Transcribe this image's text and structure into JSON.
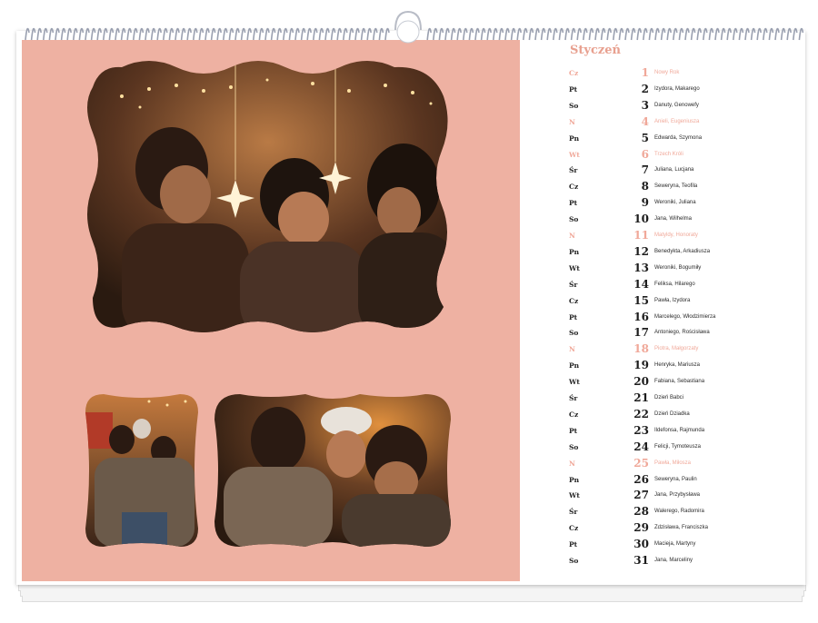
{
  "calendar": {
    "month": "Styczeń",
    "days": [
      {
        "day": "Cz",
        "num": "1",
        "names": "Nowy Rok",
        "holiday": true
      },
      {
        "day": "Pt",
        "num": "2",
        "names": "Izydora, Makarego",
        "holiday": false
      },
      {
        "day": "So",
        "num": "3",
        "names": "Danuty, Genowefy",
        "holiday": false
      },
      {
        "day": "N",
        "num": "4",
        "names": "Anieli, Eugeniusza",
        "holiday": true
      },
      {
        "day": "Pn",
        "num": "5",
        "names": "Edwarda, Szymona",
        "holiday": false
      },
      {
        "day": "Wt",
        "num": "6",
        "names": "Trzech Króli",
        "holiday": true
      },
      {
        "day": "Śr",
        "num": "7",
        "names": "Juliana, Lucjana",
        "holiday": false
      },
      {
        "day": "Cz",
        "num": "8",
        "names": "Seweryna, Teofila",
        "holiday": false
      },
      {
        "day": "Pt",
        "num": "9",
        "names": "Weroniki, Juliana",
        "holiday": false
      },
      {
        "day": "So",
        "num": "10",
        "names": "Jana, Wilhelma",
        "holiday": false
      },
      {
        "day": "N",
        "num": "11",
        "names": "Matyldy, Honoraty",
        "holiday": true
      },
      {
        "day": "Pn",
        "num": "12",
        "names": "Benedykta, Arkadiusza",
        "holiday": false
      },
      {
        "day": "Wt",
        "num": "13",
        "names": "Weroniki, Bogumiły",
        "holiday": false
      },
      {
        "day": "Śr",
        "num": "14",
        "names": "Feliksa, Hilarego",
        "holiday": false
      },
      {
        "day": "Cz",
        "num": "15",
        "names": "Pawła, Izydora",
        "holiday": false
      },
      {
        "day": "Pt",
        "num": "16",
        "names": "Marcelego, Włodzimierza",
        "holiday": false
      },
      {
        "day": "So",
        "num": "17",
        "names": "Antoniego, Rościsława",
        "holiday": false
      },
      {
        "day": "N",
        "num": "18",
        "names": "Piotra, Małgorzaty",
        "holiday": true
      },
      {
        "day": "Pn",
        "num": "19",
        "names": "Henryka, Mariusza",
        "holiday": false
      },
      {
        "day": "Wt",
        "num": "20",
        "names": "Fabiana, Sebastiana",
        "holiday": false
      },
      {
        "day": "Śr",
        "num": "21",
        "names": "Dzień Babci",
        "holiday": false
      },
      {
        "day": "Cz",
        "num": "22",
        "names": "Dzień Dziadka",
        "holiday": false
      },
      {
        "day": "Pt",
        "num": "23",
        "names": "Ildefonsa, Rajmunda",
        "holiday": false
      },
      {
        "day": "So",
        "num": "24",
        "names": "Felicji, Tymoteusza",
        "holiday": false
      },
      {
        "day": "N",
        "num": "25",
        "names": "Pawła, Miłosza",
        "holiday": true
      },
      {
        "day": "Pn",
        "num": "26",
        "names": "Seweryna, Paulin",
        "holiday": false
      },
      {
        "day": "Wt",
        "num": "27",
        "names": "Jana, Przybysława",
        "holiday": false
      },
      {
        "day": "Śr",
        "num": "28",
        "names": "Walerego, Radomira",
        "holiday": false
      },
      {
        "day": "Cz",
        "num": "29",
        "names": "Zdzisława, Franciszka",
        "holiday": false
      },
      {
        "day": "Pt",
        "num": "30",
        "names": "Macieja, Martyny",
        "holiday": false
      },
      {
        "day": "So",
        "num": "31",
        "names": "Jana, Marceliny",
        "holiday": false
      }
    ]
  },
  "colors": {
    "panel": "#eeb1a2",
    "holiday": "#f0a899",
    "title": "#e8a08f"
  }
}
